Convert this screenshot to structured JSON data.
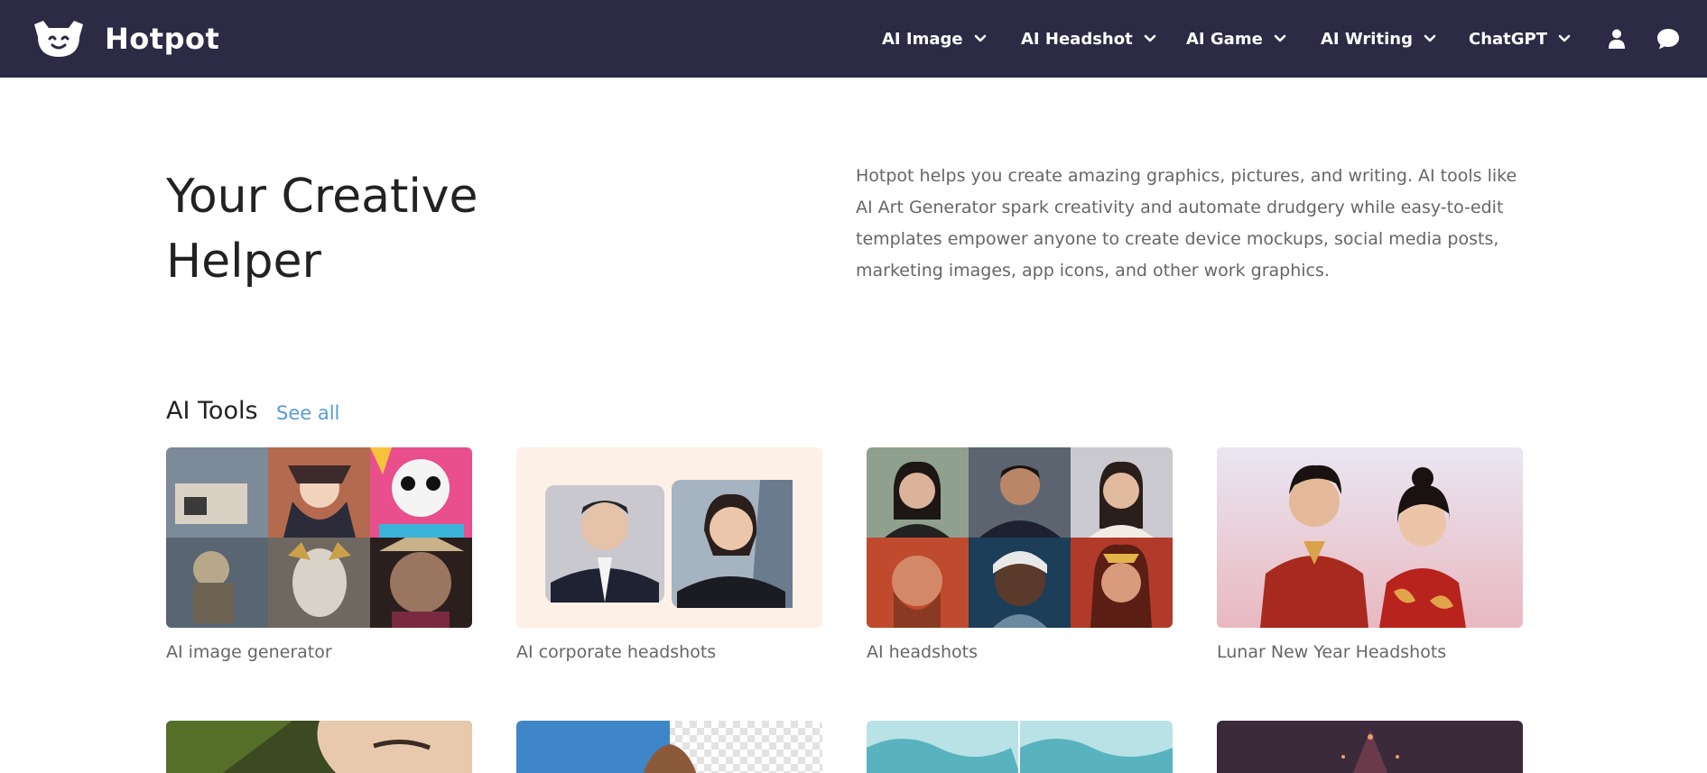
{
  "brand": {
    "name": "Hotpot"
  },
  "nav": {
    "items": [
      {
        "label": "AI Image"
      },
      {
        "label": "AI Headshot"
      },
      {
        "label": "AI Game"
      },
      {
        "label": "AI Writing"
      },
      {
        "label": "ChatGPT"
      }
    ],
    "icons": [
      "user-icon",
      "chat-bubble-icon"
    ]
  },
  "hero": {
    "title_line1": "Your Creative",
    "title_line2": "Helper",
    "description": "Hotpot helps you create amazing graphics, pictures, and writing. AI tools like AI Art Generator spark creativity and automate drudgery while easy-to-edit templates empower anyone to create device mockups, social media posts, marketing images, app icons, and other work graphics."
  },
  "ai_tools": {
    "title": "AI Tools",
    "see_all": "See all",
    "cards": [
      {
        "label": "AI image generator"
      },
      {
        "label": "AI corporate headshots"
      },
      {
        "label": "AI headshots"
      },
      {
        "label": "Lunar New Year Headshots"
      }
    ]
  },
  "colors": {
    "navbar_bg": "#2c2a44",
    "link": "#5a9bd8",
    "text_primary": "#222222",
    "text_secondary": "#666666"
  }
}
